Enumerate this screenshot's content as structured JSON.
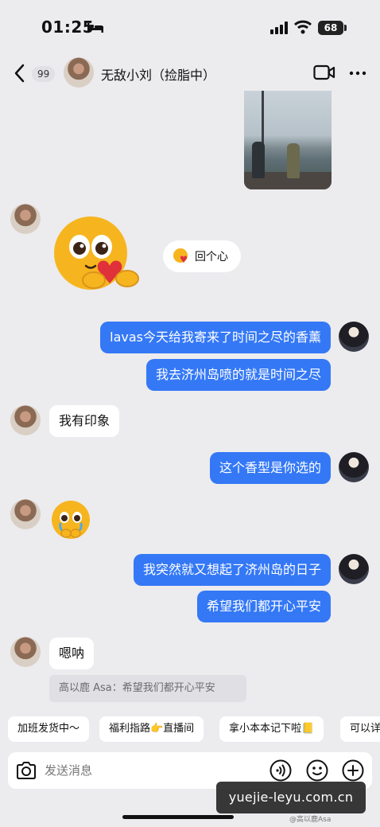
{
  "status_bar": {
    "time": "01:25",
    "battery": "68"
  },
  "header": {
    "unread_count": "99",
    "title": "无敌小刘（捡脂中）"
  },
  "messages": {
    "reaction_label": "回个心",
    "m1": "lavas今天给我寄来了时间之尽的香薰",
    "m2": "我去济州岛喷的就是时间之尽",
    "m3": "我有印象",
    "m4": "这个香型是你选的",
    "m5": "我突然就又想起了济州岛的日子",
    "m6": "希望我们都开心平安",
    "m7": "嗯呐",
    "quote": "高以鹿 Asa：希望我们都开心平安"
  },
  "quick_replies": [
    "加班发货中～",
    "福利指路👉直播间",
    "拿小本本记下啦📒",
    "可以详"
  ],
  "input": {
    "placeholder": "发送消息"
  },
  "watermark": {
    "text": "yuejie-leyu.com.cn",
    "weibo": "@高以鹿Asa"
  },
  "colors": {
    "background": "#ecebee",
    "blue_bubble": "#3478f6",
    "white_bubble": "#ffffff"
  }
}
